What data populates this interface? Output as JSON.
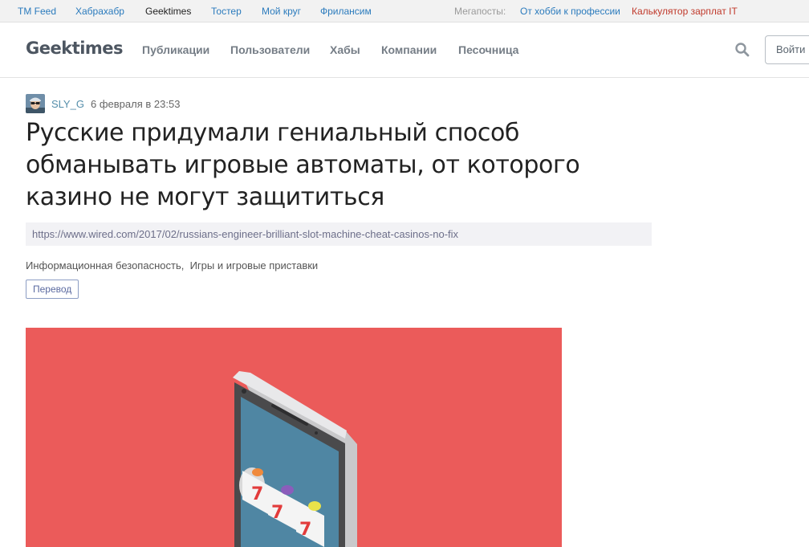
{
  "topbar": {
    "links": [
      "TM Feed",
      "Хабрахабр",
      "Geektimes",
      "Тостер",
      "Мой круг",
      "Фрилансим"
    ],
    "active": "Geektimes",
    "megaposts_label": "Мегапосты:",
    "megaposts": [
      "От хобби к профессии",
      "Калькулятор зарплат IT"
    ]
  },
  "header": {
    "logo": "Geektimes",
    "nav": [
      "Публикации",
      "Пользователи",
      "Хабы",
      "Компании",
      "Песочница"
    ],
    "login_label": "Войти"
  },
  "post": {
    "author": "SLY_G",
    "date": "6 февраля в 23:53",
    "title": "Русские придумали гениальный способ обманывать игровые автоматы, от которого казино не могут защититься",
    "source_url": "https://www.wired.com/2017/02/russians-engineer-brilliant-slot-machine-cheat-casinos-no-fix",
    "hubs": [
      "Информационная безопасность",
      "Игры и игровые приставки"
    ],
    "badge": "Перевод"
  },
  "hero": {
    "reel_symbols": [
      "7",
      "7",
      "7"
    ]
  },
  "colors": {
    "hero_bg": "#eb5b5a",
    "link": "#2b7bbd",
    "megapost_highlight": "#c0392b"
  }
}
